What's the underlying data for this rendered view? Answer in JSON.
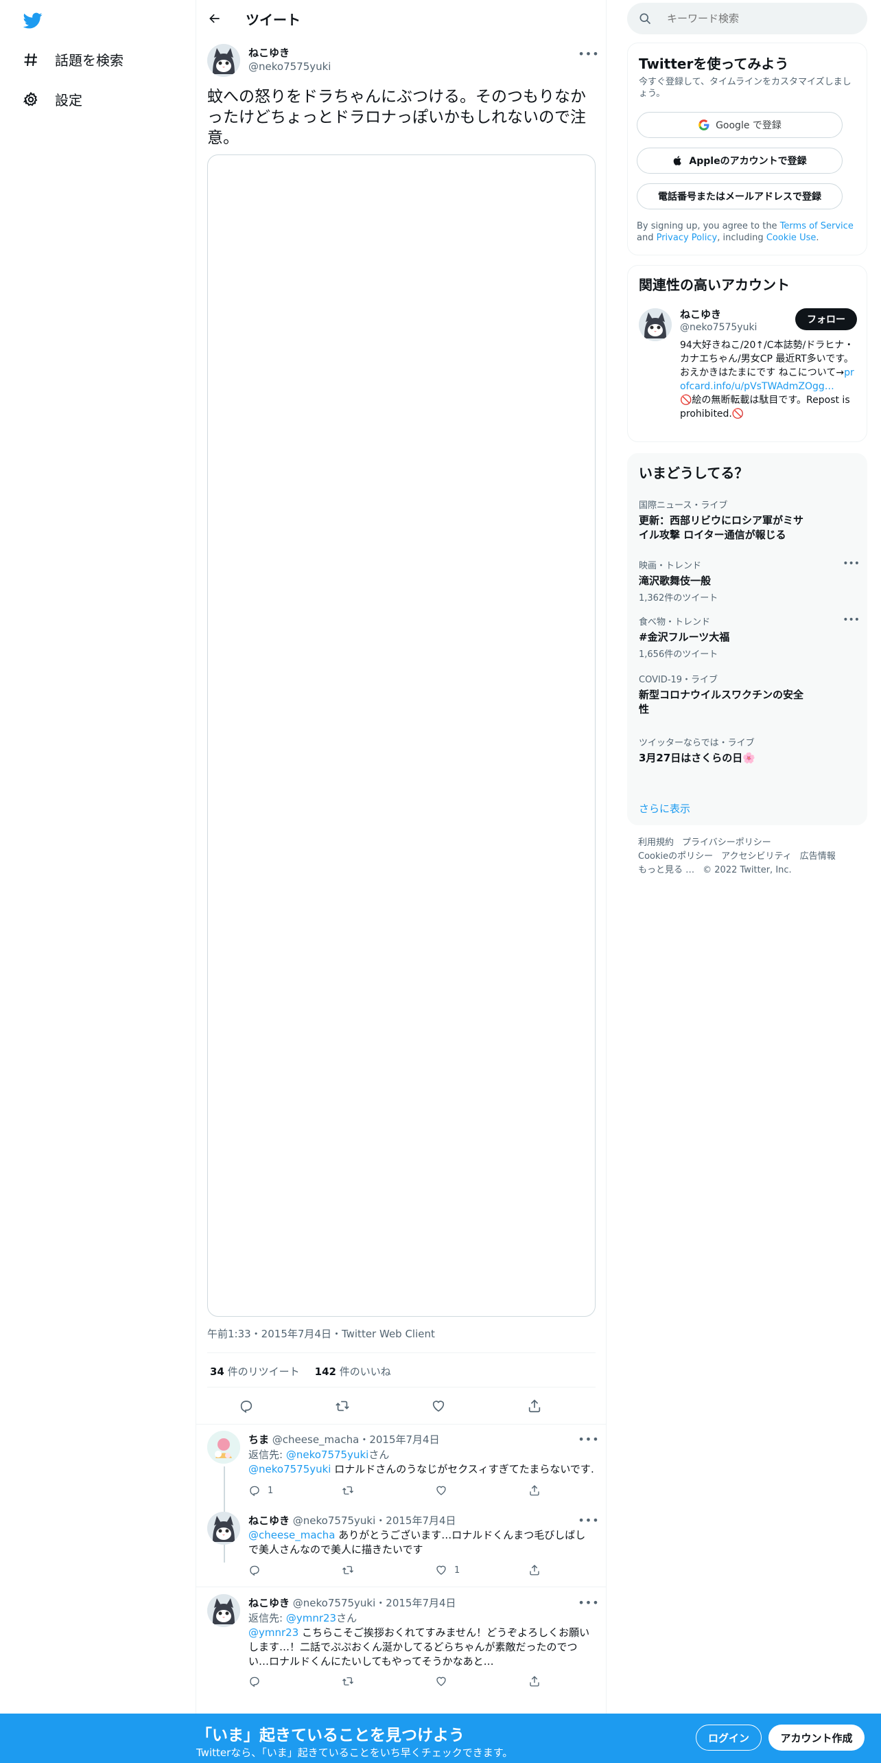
{
  "nav": {
    "explore_label": "話題を検索",
    "settings_label": "設定"
  },
  "header": {
    "title": "ツイート"
  },
  "tweet": {
    "author_name": "ねこゆき",
    "author_handle": "@neko7575yuki",
    "text": "蚊への怒りをドラちゃんにぶつける。そのつもりなかったけどちょっとドラロナっぽいかもしれないので注意。",
    "meta": "午前1:33・2015年7月4日・Twitter Web Client",
    "retweets_count": "34",
    "retweets_label": "件のリツイート",
    "likes_count": "142",
    "likes_label": "件のいいね"
  },
  "replies": [
    {
      "name": "ちま",
      "handle": "@cheese_macha",
      "date": "・2015年7月4日",
      "reply_to_prefix": "返信先:",
      "reply_to_handle": "@neko7575yuki",
      "reply_to_suffix": "さん",
      "mention": "@neko7575yuki",
      "text": " ロナルドさんのうなじがセクスィすぎてたまらないです…",
      "reply_count": "1",
      "like_count": ""
    },
    {
      "name": "ねこゆき",
      "handle": "@neko7575yuki",
      "date": "・2015年7月4日",
      "mention": "@cheese_macha",
      "text": " ありがとうございます…ロナルドくんまつ毛びしばしで美人さんなので美人に描きたいです",
      "reply_count": "",
      "like_count": "1"
    },
    {
      "name": "ねこゆき",
      "handle": "@neko7575yuki",
      "date": "・2015年7月4日",
      "reply_to_prefix": "返信先:",
      "reply_to_handle": "@ymnr23",
      "reply_to_suffix": "さん",
      "mention": "@ymnr23",
      "text": " こちらこそご挨拶おくれてすみません！どうぞよろしくお願いします…！二話でぷぷおくん涎かしてるどらちゃんが素敵だったのでつい…ロナルドくんにたいしてもやってそうかなあと…",
      "reply_count": "",
      "like_count": ""
    }
  ],
  "search": {
    "placeholder": "キーワード検索"
  },
  "signup": {
    "title": "Twitterを使ってみよう",
    "subtitle": "今すぐ登録して、タイムラインをカスタマイズしましょう。",
    "google_label": "Google で登録",
    "apple_label": "Appleのアカウントで登録",
    "phone_label": "電話番号またはメールアドレスで登録",
    "legal_prefix": "By signing up, you agree to the ",
    "terms_label": "Terms of Service",
    "legal_and": " and ",
    "privacy_label": "Privacy Policy",
    "legal_including": ", including ",
    "cookie_label": "Cookie Use",
    "legal_end": "."
  },
  "relevant": {
    "title": "関連性の高いアカウント",
    "name": "ねこゆき",
    "handle": "@neko7575yuki",
    "follow_label": "フォロー",
    "bio_before": "94大好きねこ/20↑/C本誌勢/ドラヒナ・カナエちゃん/男女CP 最近RT多いです。おえかきはたまにです ねこについて→",
    "bio_link": "profcard.info/u/pVsTWAdmZOgg…",
    "bio_after": "🚫絵の無断転載は駄目です。Repost is prohibited.🚫"
  },
  "trends": {
    "title": "いまどうしてる？",
    "items": [
      {
        "category": "国際ニュース・ライブ",
        "name": "更新：西部リビウにロシア軍がミサイル攻撃 ロイター通信が報じる",
        "count": ""
      },
      {
        "category": "映画・トレンド",
        "name": "滝沢歌舞伎一般",
        "count": "1,362件のツイート"
      },
      {
        "category": "食べ物・トレンド",
        "name": "#金沢フルーツ大福",
        "count": "1,656件のツイート"
      },
      {
        "category": "COVID-19・ライブ",
        "name": "新型コロナウイルスワクチンの安全性",
        "count": ""
      },
      {
        "category": "ツイッターならでは・ライブ",
        "name": "3月27日はさくらの日🌸",
        "count": ""
      }
    ],
    "show_more": "さらに表示"
  },
  "footer": {
    "terms": "利用規約",
    "privacy": "プライバシーポリシー",
    "cookie": "Cookieのポリシー",
    "accessibility": "アクセシビリティ",
    "ads": "広告情報",
    "more": "もっと見る …",
    "copyright": "© 2022 Twitter, Inc."
  },
  "bottom_bar": {
    "title": "「いま」起きていることを見つけよう",
    "subtitle": "Twitterなら、「いま」起きていることをいち早くチェックできます。",
    "login_label": "ログイン",
    "signup_label": "アカウント作成"
  },
  "colors": {
    "accent": "#1d9bf0",
    "text": "#0f1419",
    "muted": "#536471",
    "bottom_bar": "#1d9bf0"
  },
  "icons": [
    "twitter-logo-icon",
    "hashtag-icon",
    "gear-icon",
    "back-arrow-icon",
    "more-icon",
    "reply-icon",
    "retweet-icon",
    "like-icon",
    "share-icon",
    "search-icon",
    "google-icon",
    "apple-icon"
  ]
}
